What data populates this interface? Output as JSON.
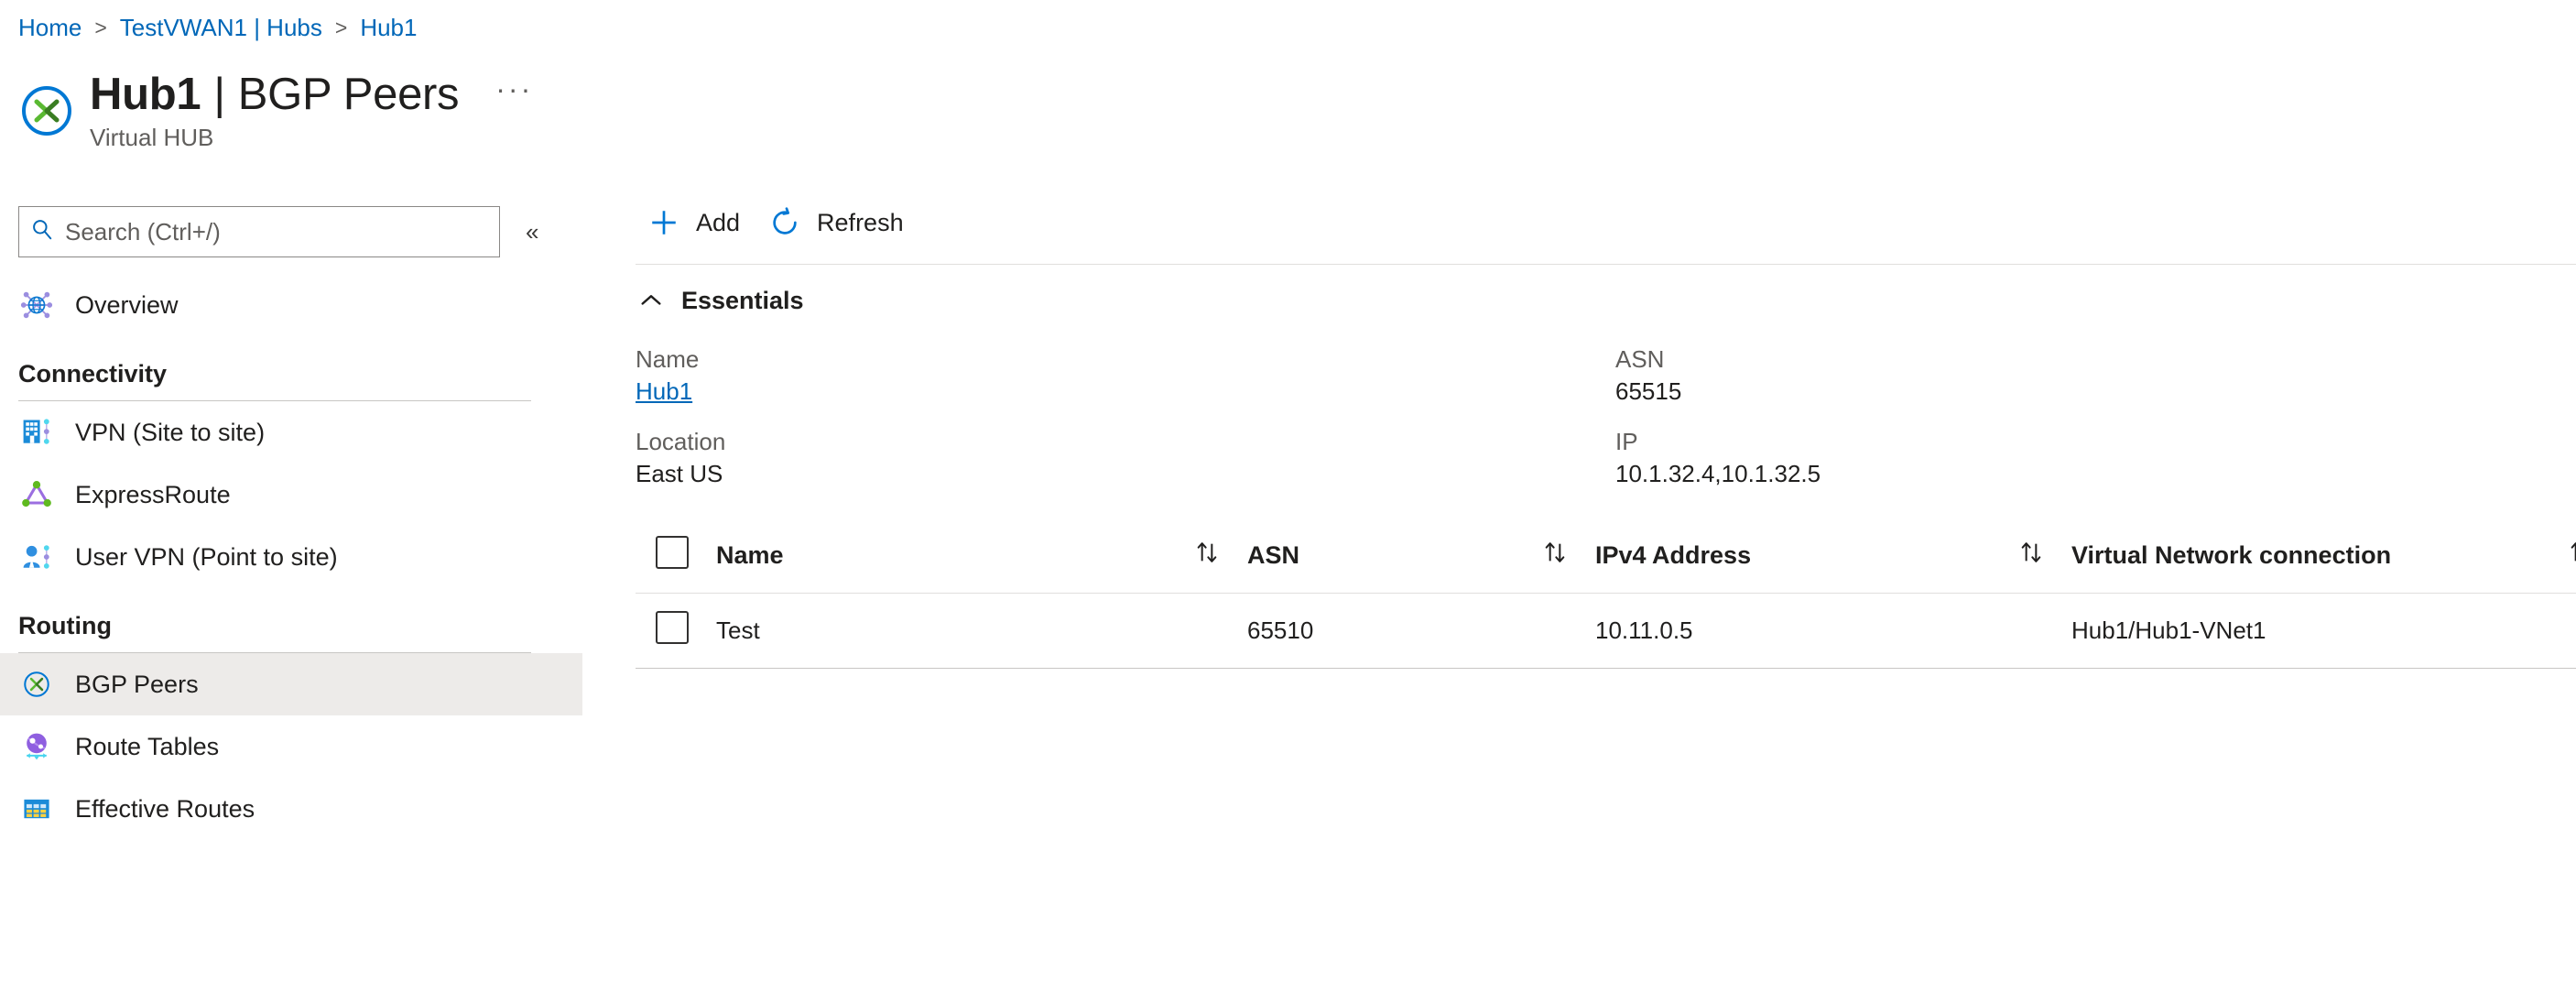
{
  "breadcrumb": {
    "items": [
      {
        "label": "Home"
      },
      {
        "label": "TestVWAN1 | Hubs"
      },
      {
        "label": "Hub1"
      }
    ],
    "separator": ">"
  },
  "header": {
    "resource_name": "Hub1",
    "divider": "|",
    "blade_name": "BGP Peers",
    "subtitle": "Virtual HUB",
    "more_label": "···",
    "icon": "vwan-hub-icon"
  },
  "sidebar": {
    "search": {
      "placeholder": "Search (Ctrl+/)",
      "value": "",
      "icon": "search-icon"
    },
    "collapse_label": "«",
    "top_items": [
      {
        "label": "Overview",
        "icon": "overview-globe-icon",
        "selected": false
      }
    ],
    "groups": [
      {
        "title": "Connectivity",
        "items": [
          {
            "label": "VPN (Site to site)",
            "icon": "vpn-site-to-site-icon",
            "selected": false
          },
          {
            "label": "ExpressRoute",
            "icon": "expressroute-icon",
            "selected": false
          },
          {
            "label": "User VPN (Point to site)",
            "icon": "user-vpn-point-to-site-icon",
            "selected": false
          }
        ]
      },
      {
        "title": "Routing",
        "items": [
          {
            "label": "BGP Peers",
            "icon": "bgp-peers-icon",
            "selected": true
          },
          {
            "label": "Route Tables",
            "icon": "route-tables-icon",
            "selected": false
          },
          {
            "label": "Effective Routes",
            "icon": "effective-routes-icon",
            "selected": false
          }
        ]
      }
    ]
  },
  "toolbar": {
    "add_label": "Add",
    "add_icon": "plus-icon",
    "refresh_label": "Refresh",
    "refresh_icon": "refresh-icon"
  },
  "essentials": {
    "title": "Essentials",
    "chevron_icon": "chevron-up-icon",
    "fields": [
      {
        "label": "Name",
        "value": "Hub1",
        "is_link": true
      },
      {
        "label": "ASN",
        "value": "65515",
        "is_link": false
      },
      {
        "label": "Location",
        "value": "East US",
        "is_link": false
      },
      {
        "label": "IP",
        "value": "10.1.32.4,10.1.32.5",
        "is_link": false
      }
    ]
  },
  "table": {
    "select_all_checkbox": false,
    "sort_icon": "sort-arrows-icon",
    "row_menu_icon": "ellipsis-icon",
    "columns": [
      {
        "key": "name",
        "label": "Name",
        "sortable": true
      },
      {
        "key": "asn",
        "label": "ASN",
        "sortable": true
      },
      {
        "key": "ipv4",
        "label": "IPv4 Address",
        "sortable": true
      },
      {
        "key": "vnet",
        "label": "Virtual Network connection",
        "sortable": true
      }
    ],
    "rows": [
      {
        "checked": false,
        "name": "Test",
        "asn": "65510",
        "ipv4": "10.11.0.5",
        "vnet": "Hub1/Hub1-VNet1",
        "more_label": "···"
      }
    ]
  },
  "colors": {
    "link": "#0067b8",
    "accent_blue": "#0078d4",
    "selected_row_bg": "#edebe9",
    "text_primary": "#201f1e",
    "text_secondary": "#605e5c",
    "border": "#c8c6c4"
  }
}
